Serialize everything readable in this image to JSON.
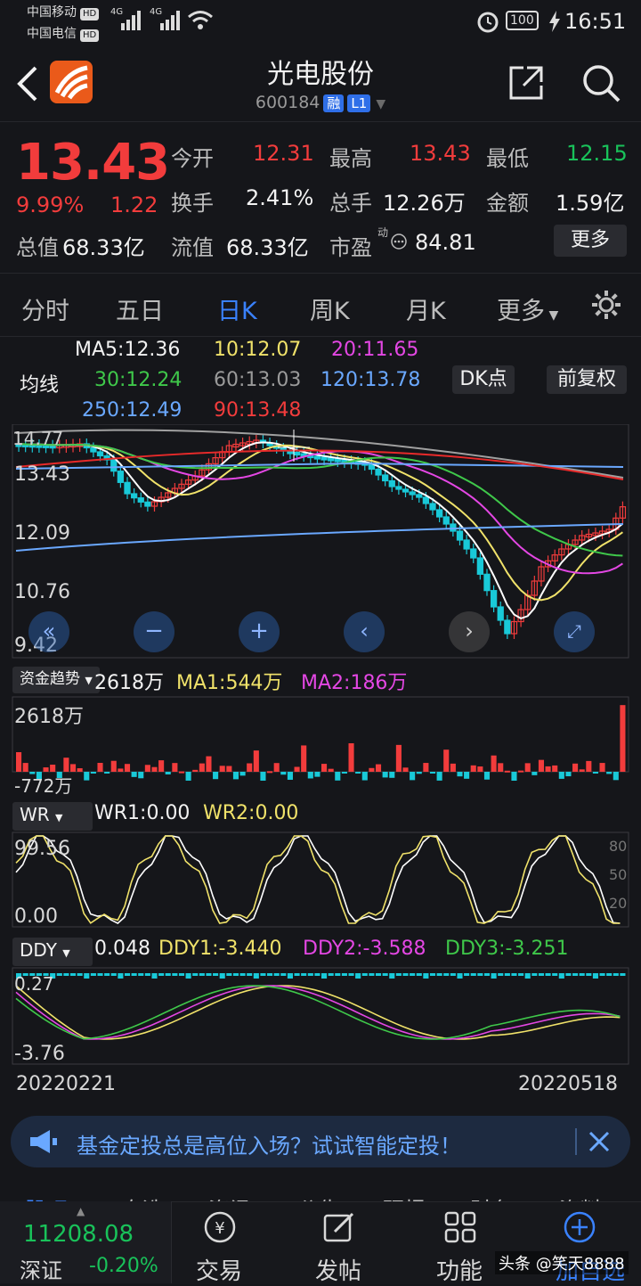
{
  "status_bar": {
    "carrier1": "中国移动",
    "carrier2": "中国电信",
    "hd": "HD",
    "net1": "4G",
    "net2": "4G",
    "battery": "100",
    "time": "16:51"
  },
  "header": {
    "title": "光电股份",
    "code": "600184",
    "tag_rong": "融",
    "tag_level": "L1"
  },
  "quote": {
    "price": "13.43",
    "change_pct": "9.99%",
    "change": "1.22",
    "open_label": "今开",
    "open": "12.31",
    "high_label": "最高",
    "high": "13.43",
    "low_label": "最低",
    "low": "12.15",
    "turnover_label": "换手",
    "turnover": "2.41%",
    "volume_label": "总手",
    "volume": "12.26万",
    "amount_label": "金额",
    "amount": "1.59亿",
    "mktcap_label": "总值",
    "mktcap": "68.33亿",
    "float_label": "流值",
    "float": "68.33亿",
    "pe_label": "市盈",
    "pe_sup": "动",
    "pe": "84.81",
    "more": "更多"
  },
  "tabs": [
    "分时",
    "五日",
    "日K",
    "周K",
    "月K",
    "更多"
  ],
  "active_tab": 2,
  "ma": {
    "label": "均线",
    "ma5": "MA5:12.36",
    "ma10": "10:12.07",
    "ma20": "20:11.65",
    "ma30": "30:12.24",
    "ma60": "60:13.03",
    "ma120": "120:13.78",
    "ma250": "250:12.49",
    "ma90": "90:13.48",
    "dk_button": "DK点",
    "fuquan_button": "前复权"
  },
  "price_axis": [
    "13.43",
    "12.09",
    "10.76",
    "9.42"
  ],
  "overlay_label": "14.77",
  "flow": {
    "name": "资金趋势",
    "value": "2618万",
    "ma1": "MA1:544万",
    "ma2": "MA2:186万",
    "axis_top": "2618万",
    "axis_bottom": "-772万"
  },
  "wr": {
    "name": "WR",
    "wr1": "WR1:0.00",
    "wr2": "WR2:0.00",
    "axis_top": "99.56",
    "axis_bottom": "0.00",
    "right_ticks": [
      "80",
      "50",
      "20"
    ]
  },
  "ddy": {
    "name": "DDY",
    "value": "0.048",
    "ddy1": "DDY1:-3.440",
    "ddy2": "DDY2:-3.588",
    "ddy3": "DDY3:-3.251",
    "axis_top": "0.27",
    "axis_bottom": "-3.76"
  },
  "dates": {
    "start": "20220221",
    "end": "20220518"
  },
  "banner": {
    "text": "基金定投总是高位入场？试试智能定投！"
  },
  "bottom": {
    "index_value": "11208.08",
    "index_name": "深证",
    "index_change": "-0.20%",
    "nav": [
      "交易",
      "发帖",
      "功能",
      "加自选"
    ],
    "hidden_tabs": [
      "股吧",
      "自选",
      "资讯",
      "公告",
      "研报",
      "财务",
      "资料"
    ],
    "watermark": "头条 @笑天8888"
  },
  "colors": {
    "up": "#f23c3c",
    "down": "#19c9d8",
    "accent": "#3a82ff",
    "ma5": "#ffffff",
    "ma10": "#f0e26a",
    "ma20": "#e447e4",
    "ma30": "#3fc84a",
    "ma60": "#a0a0a0",
    "ma120": "#6aa8ff",
    "ma90": "#e82a2a"
  }
}
